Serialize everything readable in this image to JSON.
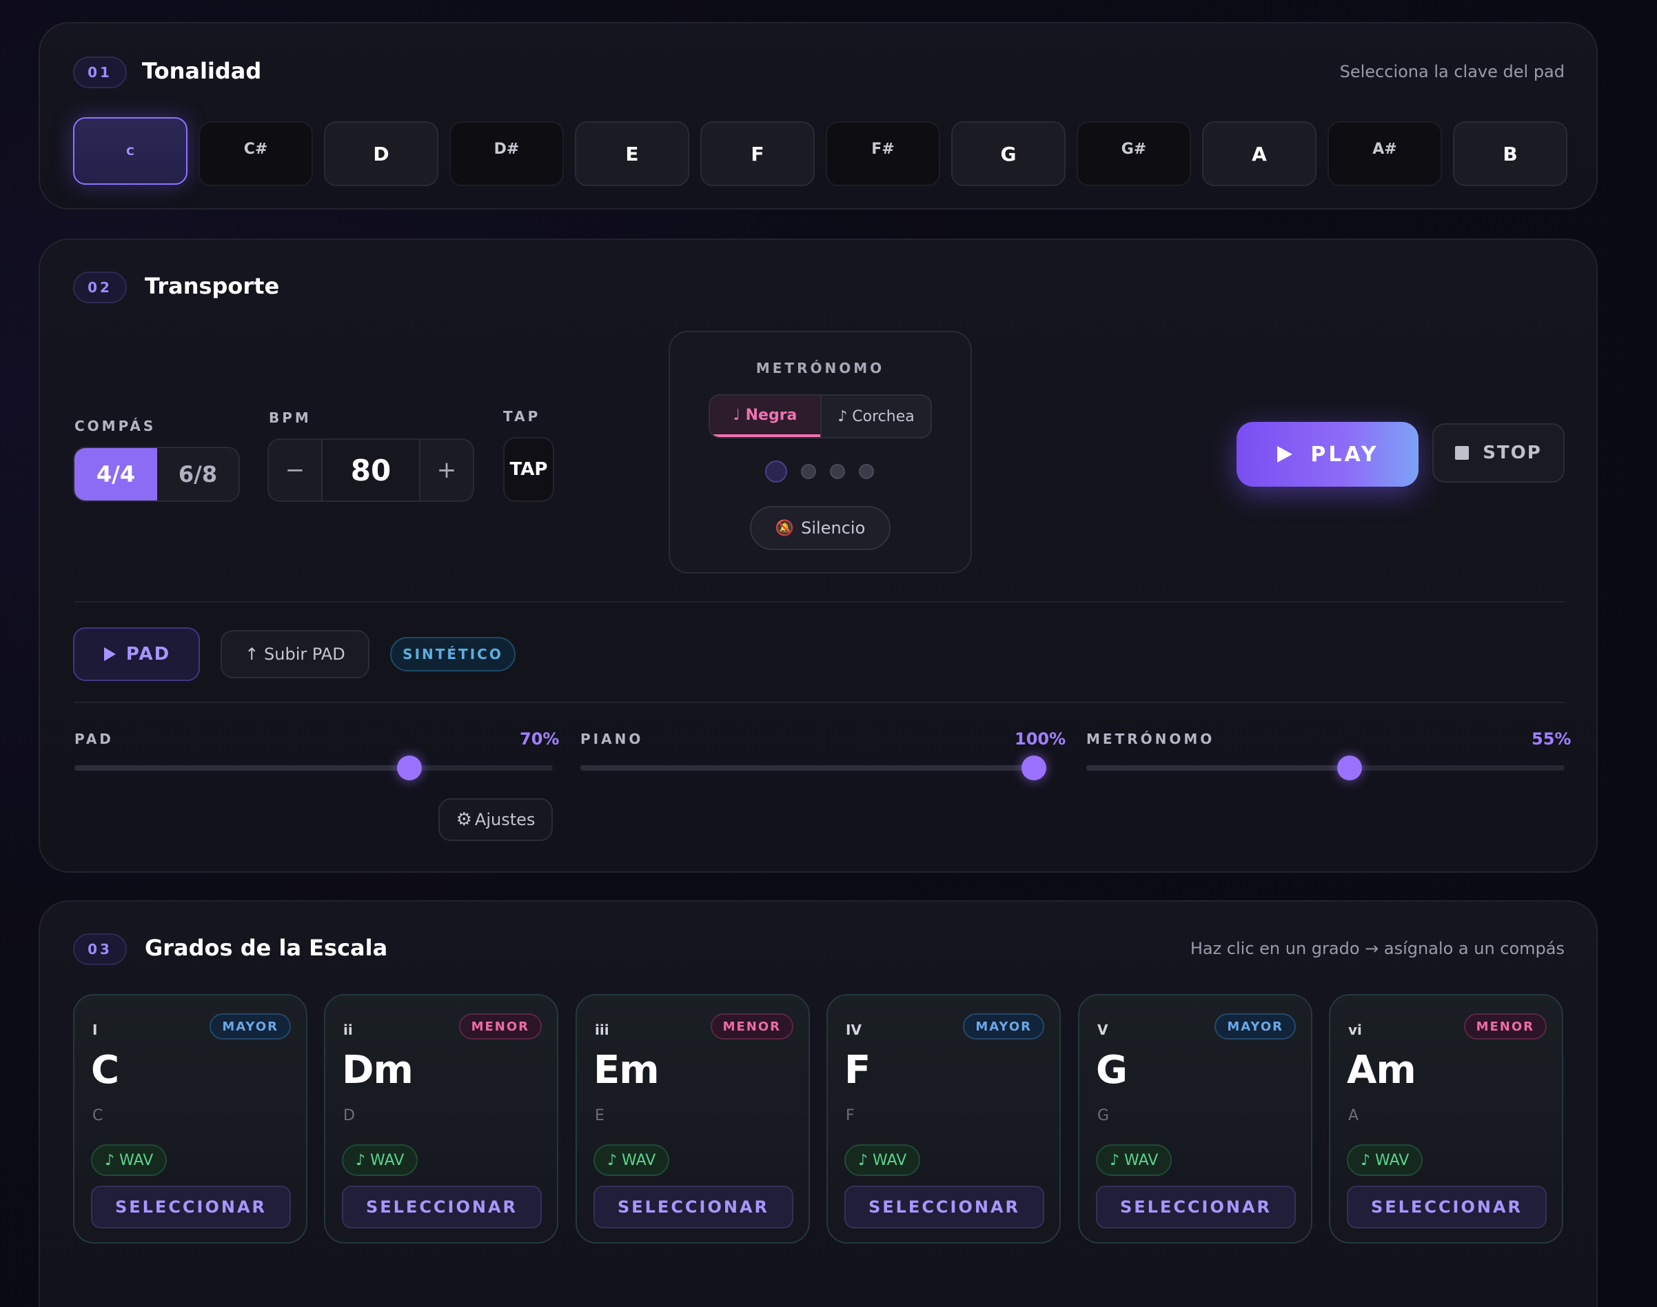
{
  "section1": {
    "number": "01",
    "title": "Tonalidad",
    "hint": "Selecciona la clave del pad",
    "keys": [
      "C",
      "C#",
      "D",
      "D#",
      "E",
      "F",
      "F#",
      "G",
      "G#",
      "A",
      "A#",
      "B"
    ],
    "selected_key": "C"
  },
  "section2": {
    "number": "02",
    "title": "Transporte",
    "compas": {
      "label": "COMPÁS",
      "options": [
        "4/4",
        "6/8"
      ],
      "selected": "4/4"
    },
    "bpm": {
      "label": "BPM",
      "value": "80",
      "minus": "−",
      "plus": "+"
    },
    "tap": {
      "label": "TAP",
      "button": "TAP"
    },
    "metronome": {
      "label": "METRÓNOMO",
      "options": [
        "♩ Negra",
        "♪ Corchea"
      ],
      "selected": "♩ Negra",
      "beats": 4,
      "active_beat": 1,
      "silence_icon": "🔕",
      "silence_label": "Silencio"
    },
    "play_label": "PLAY",
    "stop_label": "STOP",
    "pad_button": "PAD",
    "upload_pad": "↑ Subir PAD",
    "synth_badge": "SINTÉTICO",
    "sliders": [
      {
        "label": "PAD",
        "value": "70%",
        "level": 0.7
      },
      {
        "label": "PIANO",
        "value": "100%",
        "level": 1.0
      },
      {
        "label": "METRÓNOMO",
        "value": "55%",
        "level": 0.55
      }
    ],
    "settings_icon": "⚙",
    "settings_label": "Ajustes"
  },
  "section3": {
    "number": "03",
    "title": "Grados de la Escala",
    "hint": "Haz clic en un grado → asígnalo a un compás",
    "degrees": [
      {
        "roman": "I",
        "quality": "MAYOR",
        "name": "C",
        "root": "C",
        "wav": "♪ WAV",
        "select": "SELECCIONAR"
      },
      {
        "roman": "ii",
        "quality": "MENOR",
        "name": "Dm",
        "root": "D",
        "wav": "♪ WAV",
        "select": "SELECCIONAR"
      },
      {
        "roman": "iii",
        "quality": "MENOR",
        "name": "Em",
        "root": "E",
        "wav": "♪ WAV",
        "select": "SELECCIONAR"
      },
      {
        "roman": "IV",
        "quality": "MAYOR",
        "name": "F",
        "root": "F",
        "wav": "♪ WAV",
        "select": "SELECCIONAR"
      },
      {
        "roman": "V",
        "quality": "MAYOR",
        "name": "G",
        "root": "G",
        "wav": "♪ WAV",
        "select": "SELECCIONAR"
      },
      {
        "roman": "vi",
        "quality": "MENOR",
        "name": "Am",
        "root": "A",
        "wav": "♪ WAV",
        "select": "SELECCIONAR"
      }
    ]
  },
  "colors": {
    "accent": "#8d6cf5",
    "major": "#6aa8e8",
    "minor": "#f06aa8",
    "wav": "#5cd48a"
  }
}
